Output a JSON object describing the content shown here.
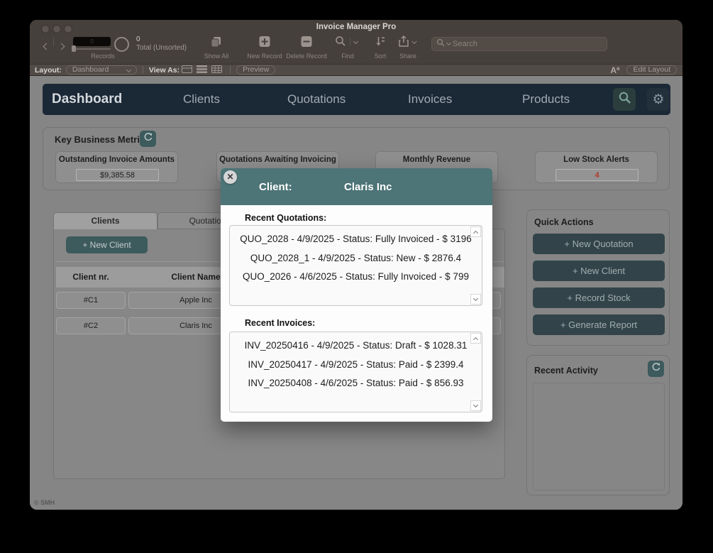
{
  "colors": {
    "accent_teal": "#3d5a5d",
    "navbar_navy": "#1b2836",
    "modal_header_teal": "#4d7477",
    "alert_red": "#b3392c",
    "button_slate": "#32444a"
  },
  "window": {
    "title": "Invoice Manager Pro",
    "copyright": "© SMH"
  },
  "toolbar": {
    "flipbook_value": "0",
    "records_count": "0",
    "records_total": "Total (Unsorted)",
    "records_label": "Records",
    "items": [
      {
        "label": "Show All",
        "icon": "show-all-icon"
      },
      {
        "label": "New Record",
        "icon": "new-record-icon"
      },
      {
        "label": "Delete Record",
        "icon": "delete-record-icon"
      },
      {
        "label": "Find",
        "icon": "find-icon"
      },
      {
        "label": "Sort",
        "icon": "sort-icon"
      },
      {
        "label": "Share",
        "icon": "share-icon"
      }
    ],
    "search_placeholder": "Search"
  },
  "layout_bar": {
    "layout_label": "Layout:",
    "layout_value": "Dashboard",
    "view_as_label": "View As:",
    "preview_label": "Preview",
    "text_zoom_glyph": "Aª",
    "edit_layout_label": "Edit Layout"
  },
  "nav": {
    "items": [
      {
        "label": "Dashboard",
        "active": true
      },
      {
        "label": "Clients",
        "active": false
      },
      {
        "label": "Quotations",
        "active": false
      },
      {
        "label": "Invoices",
        "active": false
      },
      {
        "label": "Products",
        "active": false
      }
    ]
  },
  "metrics": {
    "title": "Key Business Metrics",
    "cards": [
      {
        "title": "Outstanding Invoice Amounts",
        "value": "$9,385.58"
      },
      {
        "title": "Quotations Awaiting Invoicing",
        "value": ""
      },
      {
        "title": "Monthly Revenue",
        "value": ""
      },
      {
        "title": "Low Stock Alerts",
        "value": "4"
      }
    ]
  },
  "clients_panel": {
    "tabs": [
      {
        "label": "Clients"
      },
      {
        "label": "Quotations"
      }
    ],
    "new_client_label": "+ New Client",
    "table": {
      "columns": [
        "Client nr.",
        "Client Name"
      ],
      "rows": [
        {
          "nr": "#C1",
          "name": "Apple Inc"
        },
        {
          "nr": "#C2",
          "name": "Claris Inc"
        }
      ]
    }
  },
  "quick_actions": {
    "title": "Quick Actions",
    "buttons": [
      "+ New Quotation",
      "+ New Client",
      "+ Record Stock",
      "+ Generate Report"
    ]
  },
  "recent_activity": {
    "title": "Recent Activity"
  },
  "modal": {
    "client_label": "Client:",
    "client_name": "Claris Inc",
    "quotations_label": "Recent Quotations:",
    "quotations": [
      "QUO_2028 - 4/9/2025 - Status: Fully Invoiced - $ 3196",
      "QUO_2028_1 - 4/9/2025 - Status: New - $ 2876.4",
      "QUO_2026 - 4/6/2025 - Status: Fully Invoiced - $ 799"
    ],
    "invoices_label": "Recent Invoices:",
    "invoices": [
      "INV_20250416 - 4/9/2025 - Status: Draft - $ 1028.31",
      "INV_20250417 - 4/9/2025 - Status: Paid - $ 2399.4",
      "INV_20250408 - 4/6/2025 - Status: Paid - $ 856.93"
    ]
  }
}
